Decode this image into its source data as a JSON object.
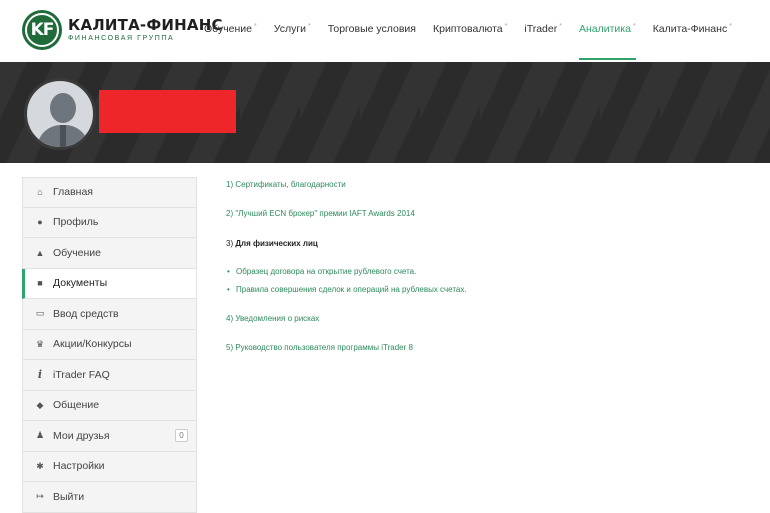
{
  "logo": {
    "initials": "KF",
    "name": "КАЛИТА-ФИНАНС",
    "subtitle": "ФИНАНСОВАЯ ГРУППА"
  },
  "nav": {
    "items": [
      {
        "label": "Обучение",
        "caret": "*"
      },
      {
        "label": "Услуги",
        "caret": "*"
      },
      {
        "label": "Торговые условия",
        "caret": ""
      },
      {
        "label": "Криптовалюта",
        "caret": "*"
      },
      {
        "label": "iTrader",
        "caret": "*"
      },
      {
        "label": "Аналитика",
        "caret": "*"
      },
      {
        "label": "Калита-Финанс",
        "caret": "*"
      }
    ],
    "active_index": 5
  },
  "sidebar": {
    "items": [
      {
        "label": "Главная",
        "icon": "home-icon",
        "glyph": "⌂"
      },
      {
        "label": "Профиль",
        "icon": "user-icon",
        "glyph": "●"
      },
      {
        "label": "Обучение",
        "icon": "graduation-cap-icon",
        "glyph": "▲"
      },
      {
        "label": "Документы",
        "icon": "book-icon",
        "glyph": "■"
      },
      {
        "label": "Ввод средств",
        "icon": "credit-card-icon",
        "glyph": "▭"
      },
      {
        "label": "Акции/Конкурсы",
        "icon": "trophy-icon",
        "glyph": "♛"
      },
      {
        "label": "iTrader FAQ",
        "icon": "info-icon",
        "glyph": "i"
      },
      {
        "label": "Общение",
        "icon": "comments-icon",
        "glyph": "◆"
      },
      {
        "label": "Мои друзья",
        "icon": "users-icon",
        "glyph": "♟",
        "badge": "0"
      },
      {
        "label": "Настройки",
        "icon": "gear-icon",
        "glyph": "✱"
      },
      {
        "label": "Выйти",
        "icon": "sign-out-icon",
        "glyph": "↦"
      }
    ],
    "active_index": 3
  },
  "content": {
    "line1": "1) Сертификаты, благодарности",
    "line2": "2) \"Лучший ECN брокер\" премии IAFT Awards 2014",
    "line3_prefix": "3) ",
    "line3_bold": "Для физических лиц",
    "bullet1": "Образец договора на открытие рублевого счета.",
    "bullet2": "Правила совершения сделок и операций на рублевых счетах.",
    "line4": "4) Уведомления о рисках",
    "line5": "5) Руководство пользователя программы iTrader 8"
  },
  "colors": {
    "accent": "#2fa36b",
    "brand": "#1f6b3a",
    "banner": "#2b2b2b",
    "redacted": "#ee2529"
  }
}
